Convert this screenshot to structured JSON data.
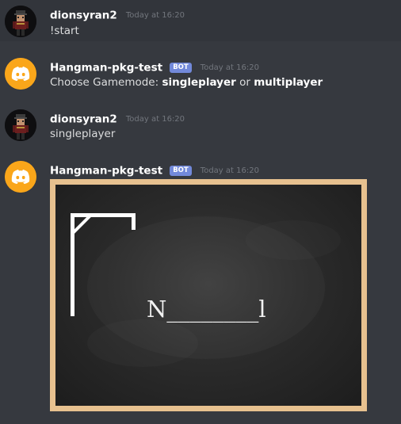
{
  "messages": [
    {
      "username": "dionsyran2",
      "is_bot": false,
      "timestamp": "Today at 16:20",
      "text": "!start"
    },
    {
      "username": "Hangman-pkg-test",
      "is_bot": true,
      "bot_tag": "BOT",
      "timestamp": "Today at 16:20",
      "text_prefix": "Choose Gamemode: ",
      "option_1": "singleplayer",
      "text_middle": " or ",
      "option_2": "multiplayer"
    },
    {
      "username": "dionsyran2",
      "is_bot": false,
      "timestamp": "Today at 16:20",
      "text": "singleplayer"
    },
    {
      "username": "Hangman-pkg-test",
      "is_bot": true,
      "bot_tag": "BOT",
      "timestamp": "Today at 16:20",
      "image": {
        "word_display": "N________l"
      }
    }
  ],
  "colors": {
    "background": "#36393f",
    "hover_background": "#32353b",
    "bot_tag": "#7289da",
    "bot_avatar": "#faa61a",
    "timestamp": "#72767d",
    "chalkboard": "#2b2b2b",
    "board_frame": "#e7c18f"
  },
  "icons": {
    "user_avatar": "pixel-character-avatar",
    "bot_avatar": "discord-logo-icon",
    "gallows": "hangman-gallows-icon"
  }
}
